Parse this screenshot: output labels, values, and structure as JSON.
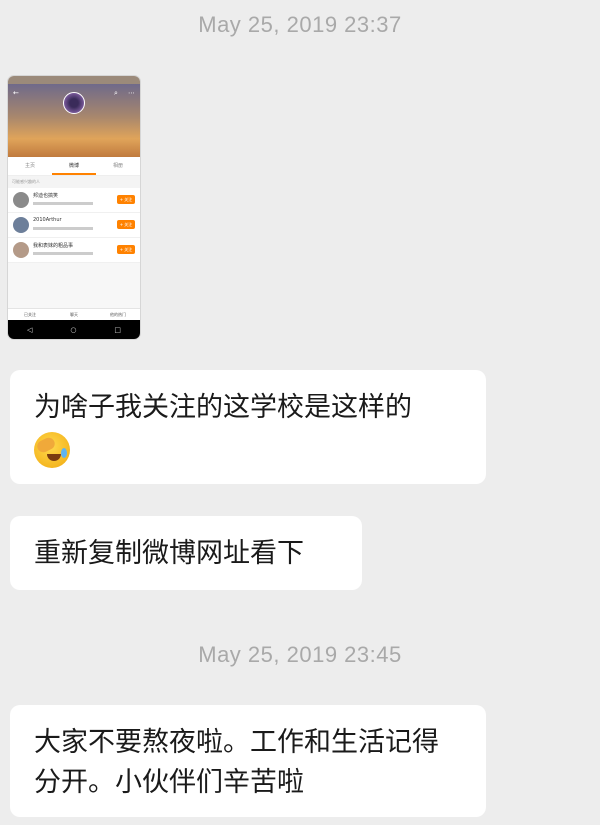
{
  "messages": [
    {
      "timestamp": "May 25, 2019 23:37"
    },
    {
      "image": {
        "tabs": [
          "主页",
          "微博",
          "相册"
        ],
        "list_header": "可能感兴趣的人",
        "rows": [
          {
            "name": "邦迪也搞笑",
            "follow": "+ 关注"
          },
          {
            "name": "2010Arthur",
            "follow": "+ 关注"
          },
          {
            "name": "我和表妹的粗品事",
            "follow": "+ 关注"
          }
        ],
        "bottom_bar": [
          "已关注",
          "聊天",
          "他的热门"
        ],
        "nav": [
          "◁",
          "○",
          "□"
        ]
      }
    },
    {
      "text": "为啥子我关注的这学校是这样的",
      "emoji": "face-palm-laugh-icon"
    },
    {
      "text": "重新复制微博网址看下"
    },
    {
      "timestamp": "May 25, 2019 23:45"
    },
    {
      "text": "大家不要熬夜啦。工作和生活记得分开。小伙伴们辛苦啦"
    }
  ],
  "colors": {
    "background": "#ededed",
    "bubble": "#ffffff",
    "timestamp": "#a9a9a9",
    "weibo_orange": "#ff8200"
  }
}
